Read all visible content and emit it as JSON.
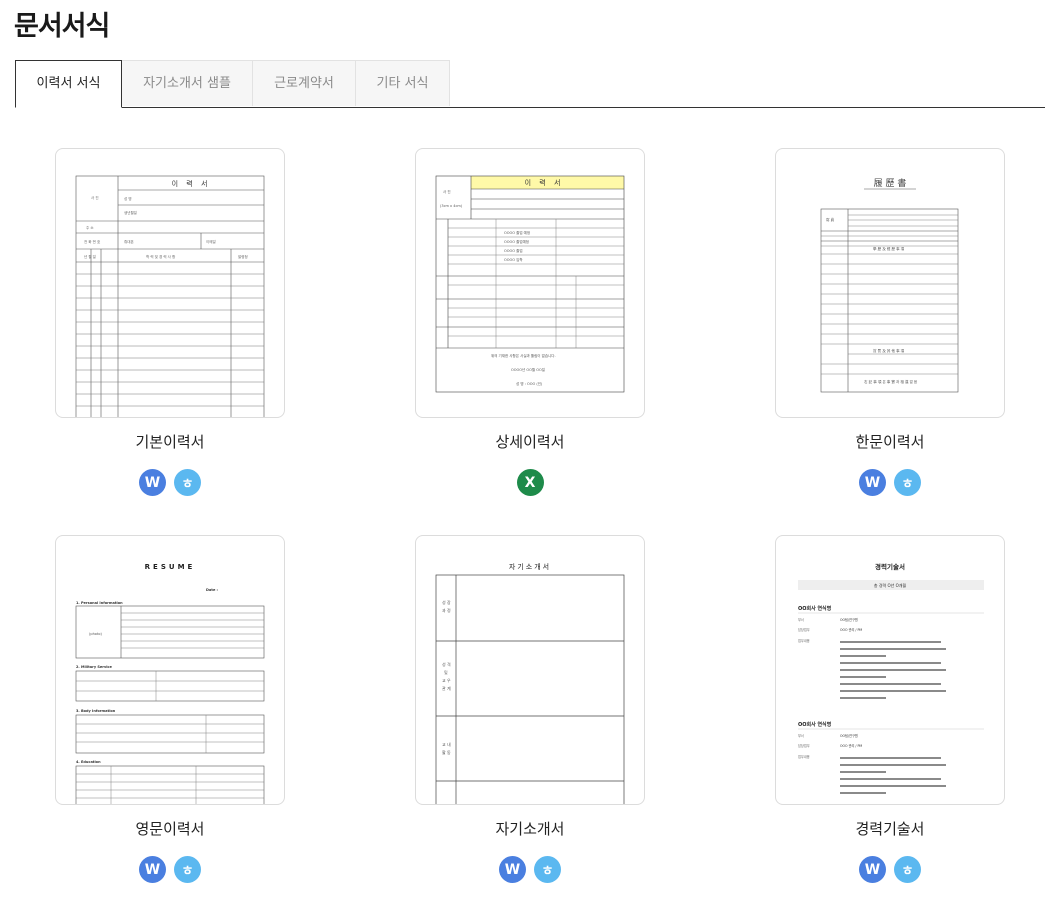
{
  "title": "문서서식",
  "tabs": [
    "이력서 서식",
    "자기소개서 샘플",
    "근로계약서",
    "기타 서식"
  ],
  "cards": [
    {
      "name": "기본이력서",
      "badges": [
        "W",
        "ㅎ"
      ]
    },
    {
      "name": "상세이력서",
      "badges": [
        "X"
      ]
    },
    {
      "name": "한문이력서",
      "badges": [
        "W",
        "ㅎ"
      ]
    },
    {
      "name": "영문이력서",
      "badges": [
        "W",
        "ㅎ"
      ]
    },
    {
      "name": "자기소개서",
      "badges": [
        "W",
        "ㅎ"
      ]
    },
    {
      "name": "경력기술서",
      "badges": [
        "W",
        "ㅎ"
      ]
    }
  ],
  "thumbs": {
    "basic": {
      "title": "이 력 서"
    },
    "detail": {
      "title": "이 력 서"
    },
    "hanja": {
      "title": "履 歷 書"
    },
    "english": {
      "title": "RESUME"
    },
    "intro": {
      "title": "자기소개서",
      "rows": [
        "성장\n과정",
        "성격\n및\n교우\n관계",
        "교내\n활동"
      ]
    },
    "career": {
      "title": "경력기술서",
      "subtitle": "총 경력 O년 O개월",
      "company1": "OO회사 연식명",
      "company2": "OO회사 연식명"
    }
  },
  "colors": {
    "word": "#4a7fe0",
    "hwp": "#5bb8f0",
    "excel": "#1e8b4a",
    "highlight": "#fff9a8"
  }
}
